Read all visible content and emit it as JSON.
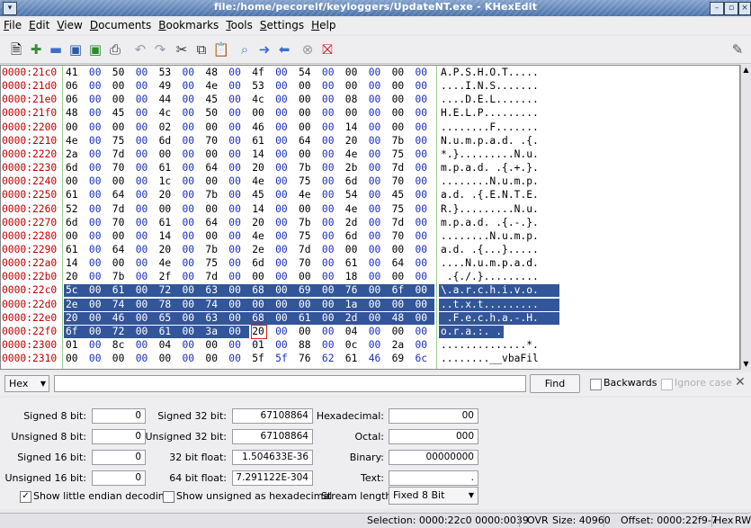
{
  "window": {
    "title": "file:/home/pecorelf/keyloggers/UpdateNT.exe - KHexEdit"
  },
  "menu": [
    "File",
    "Edit",
    "View",
    "Documents",
    "Bookmarks",
    "Tools",
    "Settings",
    "Help"
  ],
  "toolbar_icons": [
    "new-file-icon",
    "open-file-icon",
    "folder-icon",
    "save-icon",
    "save-as-icon",
    "print-icon",
    "undo-icon",
    "redo-icon",
    "cut-icon",
    "copy-icon",
    "paste-icon",
    "find-icon",
    "forward-icon",
    "back-icon",
    "stop-icon",
    "close-icon"
  ],
  "hex_rows": [
    {
      "offset": "0000:21c0",
      "bytes": [
        "41",
        "00",
        "50",
        "00",
        "53",
        "00",
        "48",
        "00",
        "4f",
        "00",
        "54",
        "00",
        "00",
        "00",
        "00",
        "00"
      ],
      "ascii": "A.P.S.H.O.T....."
    },
    {
      "offset": "0000:21d0",
      "bytes": [
        "06",
        "00",
        "00",
        "00",
        "49",
        "00",
        "4e",
        "00",
        "53",
        "00",
        "00",
        "00",
        "00",
        "00",
        "00",
        "00"
      ],
      "ascii": "....I.N.S......."
    },
    {
      "offset": "0000:21e0",
      "bytes": [
        "06",
        "00",
        "00",
        "00",
        "44",
        "00",
        "45",
        "00",
        "4c",
        "00",
        "00",
        "00",
        "08",
        "00",
        "00",
        "00"
      ],
      "ascii": "....D.E.L......."
    },
    {
      "offset": "0000:21f0",
      "bytes": [
        "48",
        "00",
        "45",
        "00",
        "4c",
        "00",
        "50",
        "00",
        "00",
        "00",
        "00",
        "00",
        "00",
        "00",
        "00",
        "00"
      ],
      "ascii": "H.E.L.P........."
    },
    {
      "offset": "0000:2200",
      "bytes": [
        "00",
        "00",
        "00",
        "00",
        "02",
        "00",
        "00",
        "00",
        "46",
        "00",
        "00",
        "00",
        "14",
        "00",
        "00",
        "00"
      ],
      "ascii": "........F......."
    },
    {
      "offset": "0000:2210",
      "bytes": [
        "4e",
        "00",
        "75",
        "00",
        "6d",
        "00",
        "70",
        "00",
        "61",
        "00",
        "64",
        "00",
        "20",
        "00",
        "7b",
        "00"
      ],
      "ascii": "N.u.m.p.a.d. .{."
    },
    {
      "offset": "0000:2220",
      "bytes": [
        "2a",
        "00",
        "7d",
        "00",
        "00",
        "00",
        "00",
        "00",
        "14",
        "00",
        "00",
        "00",
        "4e",
        "00",
        "75",
        "00"
      ],
      "ascii": "*.}.........N.u."
    },
    {
      "offset": "0000:2230",
      "bytes": [
        "6d",
        "00",
        "70",
        "00",
        "61",
        "00",
        "64",
        "00",
        "20",
        "00",
        "7b",
        "00",
        "2b",
        "00",
        "7d",
        "00"
      ],
      "ascii": "m.p.a.d. .{.+.}."
    },
    {
      "offset": "0000:2240",
      "bytes": [
        "00",
        "00",
        "00",
        "00",
        "1c",
        "00",
        "00",
        "00",
        "4e",
        "00",
        "75",
        "00",
        "6d",
        "00",
        "70",
        "00"
      ],
      "ascii": "........N.u.m.p."
    },
    {
      "offset": "0000:2250",
      "bytes": [
        "61",
        "00",
        "64",
        "00",
        "20",
        "00",
        "7b",
        "00",
        "45",
        "00",
        "4e",
        "00",
        "54",
        "00",
        "45",
        "00"
      ],
      "ascii": "a.d. .{.E.N.T.E."
    },
    {
      "offset": "0000:2260",
      "bytes": [
        "52",
        "00",
        "7d",
        "00",
        "00",
        "00",
        "00",
        "00",
        "14",
        "00",
        "00",
        "00",
        "4e",
        "00",
        "75",
        "00"
      ],
      "ascii": "R.}.........N.u."
    },
    {
      "offset": "0000:2270",
      "bytes": [
        "6d",
        "00",
        "70",
        "00",
        "61",
        "00",
        "64",
        "00",
        "20",
        "00",
        "7b",
        "00",
        "2d",
        "00",
        "7d",
        "00"
      ],
      "ascii": "m.p.a.d. .{.-.}."
    },
    {
      "offset": "0000:2280",
      "bytes": [
        "00",
        "00",
        "00",
        "00",
        "14",
        "00",
        "00",
        "00",
        "4e",
        "00",
        "75",
        "00",
        "6d",
        "00",
        "70",
        "00"
      ],
      "ascii": "........N.u.m.p."
    },
    {
      "offset": "0000:2290",
      "bytes": [
        "61",
        "00",
        "64",
        "00",
        "20",
        "00",
        "7b",
        "00",
        "2e",
        "00",
        "7d",
        "00",
        "00",
        "00",
        "00",
        "00"
      ],
      "ascii": "a.d. .{...}....."
    },
    {
      "offset": "0000:22a0",
      "bytes": [
        "14",
        "00",
        "00",
        "00",
        "4e",
        "00",
        "75",
        "00",
        "6d",
        "00",
        "70",
        "00",
        "61",
        "00",
        "64",
        "00"
      ],
      "ascii": "....N.u.m.p.a.d."
    },
    {
      "offset": "0000:22b0",
      "bytes": [
        "20",
        "00",
        "7b",
        "00",
        "2f",
        "00",
        "7d",
        "00",
        "00",
        "00",
        "00",
        "00",
        "18",
        "00",
        "00",
        "00"
      ],
      "ascii": " .{./.}........."
    },
    {
      "offset": "0000:22c0",
      "bytes": [
        "5c",
        "00",
        "61",
        "00",
        "72",
        "00",
        "63",
        "00",
        "68",
        "00",
        "69",
        "00",
        "76",
        "00",
        "6f",
        "00"
      ],
      "ascii": "\\.a.r.c.h.i.v.o."
    },
    {
      "offset": "0000:22d0",
      "bytes": [
        "2e",
        "00",
        "74",
        "00",
        "78",
        "00",
        "74",
        "00",
        "00",
        "00",
        "00",
        "00",
        "1a",
        "00",
        "00",
        "00"
      ],
      "ascii": "..t.x.t........."
    },
    {
      "offset": "0000:22e0",
      "bytes": [
        "20",
        "00",
        "46",
        "00",
        "65",
        "00",
        "63",
        "00",
        "68",
        "00",
        "61",
        "00",
        "2d",
        "00",
        "48",
        "00"
      ],
      "ascii": " .F.e.c.h.a.-.H."
    },
    {
      "offset": "0000:22f0",
      "bytes": [
        "6f",
        "00",
        "72",
        "00",
        "61",
        "00",
        "3a",
        "00",
        "20",
        "00",
        "00",
        "00",
        "04",
        "00",
        "00",
        "00"
      ],
      "ascii": "o.r.a.:. ......."
    },
    {
      "offset": "0000:2300",
      "bytes": [
        "01",
        "00",
        "8c",
        "00",
        "04",
        "00",
        "00",
        "00",
        "01",
        "00",
        "88",
        "00",
        "0c",
        "00",
        "2a",
        "00"
      ],
      "ascii": "..............*."
    },
    {
      "offset": "0000:2310",
      "bytes": [
        "00",
        "00",
        "00",
        "00",
        "00",
        "00",
        "00",
        "00",
        "5f",
        "5f",
        "76",
        "62",
        "61",
        "46",
        "69",
        "6c"
      ],
      "ascii": "........__vbaFil"
    }
  ],
  "search": {
    "mode": "Hex",
    "value": "",
    "find_label": "Find",
    "backwards_label": "Backwards",
    "ignore_case_label": "Ignore case"
  },
  "converter": {
    "signed8_label": "Signed 8 bit:",
    "signed8": "0",
    "unsigned8_label": "Unsigned 8 bit:",
    "unsigned8": "0",
    "signed16_label": "Signed 16 bit:",
    "signed16": "0",
    "unsigned16_label": "Unsigned 16 bit:",
    "unsigned16": "0",
    "signed32_label": "Signed 32 bit:",
    "signed32": "67108864",
    "unsigned32_label": "Unsigned 32 bit:",
    "unsigned32": "67108864",
    "float32_label": "32 bit float:",
    "float32": "1.504633E-36",
    "float64_label": "64 bit float:",
    "float64": "7.291122E-304",
    "hex_label": "Hexadecimal:",
    "hex": "00",
    "octal_label": "Octal:",
    "octal": "000",
    "binary_label": "Binary:",
    "binary": "00000000",
    "text_label": "Text:",
    "text": ".",
    "little_endian_label": "Show little endian decoding",
    "unsigned_hex_label": "Show unsigned as hexadecimal",
    "stream_length_label": "Stream length:",
    "stream_length": "Fixed 8 Bit"
  },
  "status": {
    "selection": "Selection: 0000:22c0 0000:0039",
    "ovr": "OVR",
    "size": "Size: 40960",
    "offset": "Offset: 0000:22f9-7",
    "mode": "Hex",
    "rw": "RW"
  },
  "colors": {
    "offset": "#c00000",
    "even_byte": "#000000",
    "odd_byte": "#1a2fbf",
    "selection": "#33559a",
    "ascii_dot": "#d01010"
  }
}
